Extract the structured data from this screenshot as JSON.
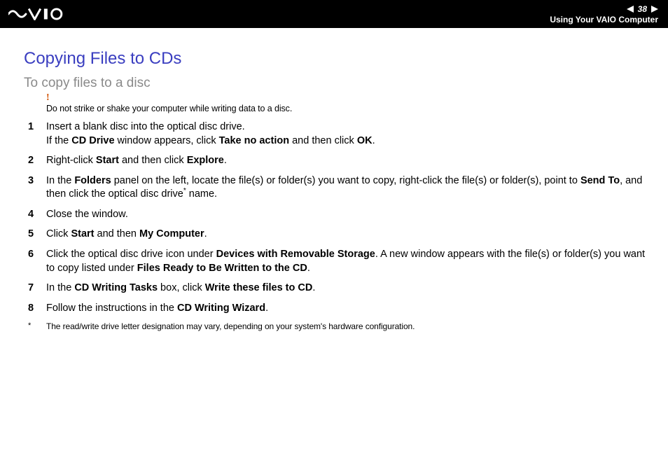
{
  "header": {
    "page_number": "38",
    "section": "Using Your VAIO Computer"
  },
  "title": "Copying Files to CDs",
  "subtitle": "To copy files to a disc",
  "warning": {
    "mark": "!",
    "text": "Do not strike or shake your computer while writing data to a disc."
  },
  "steps": [
    {
      "parts": [
        {
          "t": "Insert a blank disc into the optical disc drive."
        },
        {
          "br": true
        },
        {
          "t": "If the "
        },
        {
          "b": "CD Drive"
        },
        {
          "t": " window appears, click "
        },
        {
          "b": "Take no action"
        },
        {
          "t": " and then click "
        },
        {
          "b": "OK"
        },
        {
          "t": "."
        }
      ]
    },
    {
      "parts": [
        {
          "t": "Right-click "
        },
        {
          "b": "Start"
        },
        {
          "t": " and then click "
        },
        {
          "b": "Explore"
        },
        {
          "t": "."
        }
      ]
    },
    {
      "parts": [
        {
          "t": "In the "
        },
        {
          "b": "Folders"
        },
        {
          "t": " panel on the left, locate the file(s) or folder(s) you want to copy, right-click the file(s) or folder(s), point to "
        },
        {
          "b": "Send To"
        },
        {
          "t": ", and then click the optical disc drive"
        },
        {
          "sup": "*"
        },
        {
          "t": " name."
        }
      ]
    },
    {
      "parts": [
        {
          "t": "Close the window."
        }
      ]
    },
    {
      "parts": [
        {
          "t": "Click "
        },
        {
          "b": "Start"
        },
        {
          "t": " and then "
        },
        {
          "b": "My Computer"
        },
        {
          "t": "."
        }
      ]
    },
    {
      "parts": [
        {
          "t": "Click the optical disc drive icon under "
        },
        {
          "b": "Devices with Removable Storage"
        },
        {
          "t": ". A new window appears with the file(s) or folder(s) you want to copy listed under "
        },
        {
          "b": "Files Ready to Be Written to the CD"
        },
        {
          "t": "."
        }
      ]
    },
    {
      "parts": [
        {
          "t": "In the "
        },
        {
          "b": "CD Writing Tasks"
        },
        {
          "t": " box, click "
        },
        {
          "b": "Write these files to CD"
        },
        {
          "t": "."
        }
      ]
    },
    {
      "parts": [
        {
          "t": "Follow the instructions in the "
        },
        {
          "b": "CD Writing Wizard"
        },
        {
          "t": "."
        }
      ]
    }
  ],
  "footnote": {
    "mark": "*",
    "text": "The read/write drive letter designation may vary, depending on your system's hardware configuration."
  }
}
